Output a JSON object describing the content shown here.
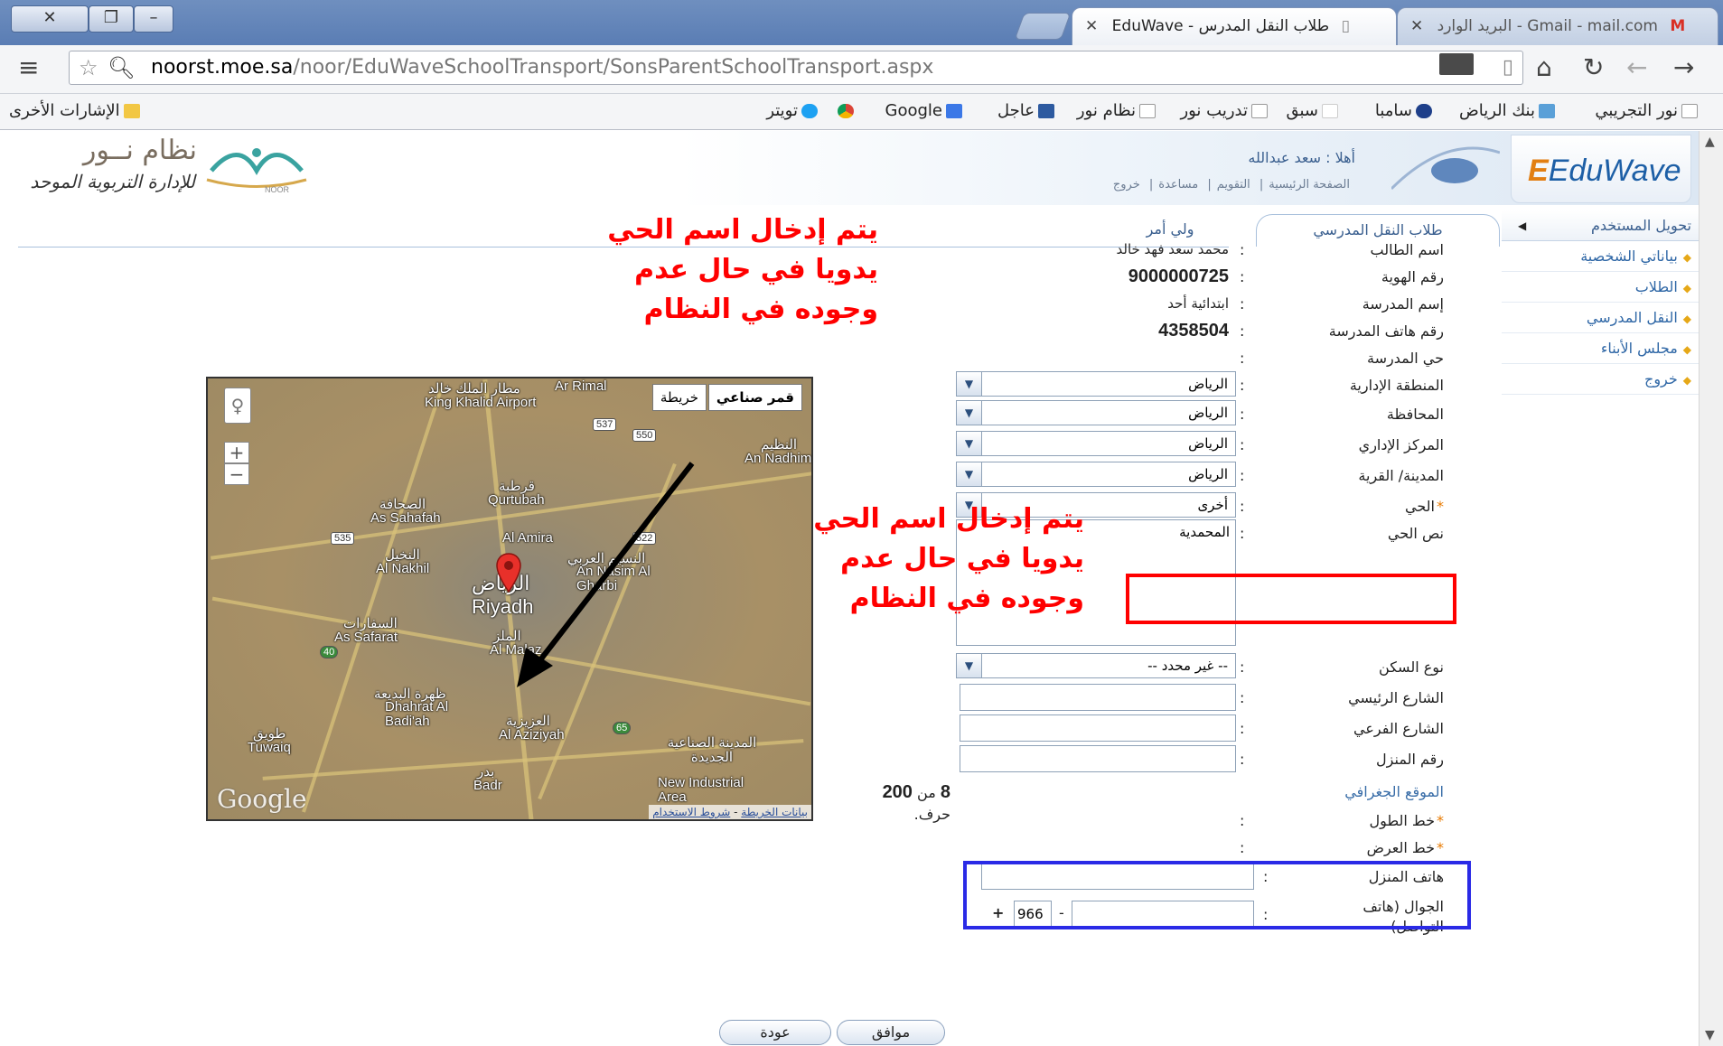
{
  "browser": {
    "tabs": [
      {
        "title": "EduWave - طلاب النقل المدرس",
        "active": true
      },
      {
        "title": "البريد الوارد - Gmail - mail.com",
        "active": false
      }
    ],
    "url_host": "noorst.moe.sa",
    "url_path": "/noor/EduWaveSchoolTransport/SonsParentSchoolTransport.aspx",
    "bookmarks": [
      "نور التجريبي",
      "بنك الرياض",
      "سامبا",
      "سبق",
      "تدريب نور",
      "نظام نور",
      "عاجل",
      "Google",
      "تويتر"
    ],
    "other_bookmarks": "الإشارات الأخرى"
  },
  "header": {
    "eduwave_logo": "EduWave",
    "hello": "أهلا : سعد عبدالله",
    "links": [
      "الصفحة الرئيسية",
      "التقويم",
      "مساعدة",
      "خروج"
    ],
    "noor_title": "نظام نــور",
    "noor_subtitle": "للإدارة التربوية الموحد",
    "noor_small": "NOOR"
  },
  "page_tabs": {
    "active": "طلاب النقل المدرسي",
    "other": "ولي أمر"
  },
  "sidebar": {
    "head": "تحويل المستخدم",
    "items": [
      "بياناتي الشخصية",
      "الطلاب",
      "النقل المدرسي",
      "مجلس الأبناء",
      "خروج"
    ]
  },
  "form": {
    "student_name_label": "اسم الطالب",
    "student_name": "محمد سعد فهد خالد",
    "id_label": "رقم الهوية",
    "id_value": "9000000725",
    "school_label": "إسم المدرسة",
    "school_value": "ابتدائية أحد",
    "school_phone_label": "رقم هاتف المدرسة",
    "school_phone": "4358504",
    "school_district_label": "حي المدرسة",
    "region_label": "المنطقة الإدارية",
    "region": "الرياض",
    "governorate_label": "المحافظة",
    "governorate": "الرياض",
    "center_label": "المركز الإداري",
    "center": "الرياض",
    "city_label": "المدينة/ القرية",
    "city": "الرياض",
    "district_label": "الحي",
    "district": "أخرى",
    "district_text_label": "نص الحي",
    "district_text": "المحمدية",
    "char_count": "8",
    "char_of": "من",
    "char_max": "200",
    "char_unit": "حرف.",
    "housing_label": "نوع السكن",
    "housing": "-- غير محدد --",
    "main_street_label": "الشارع الرئيسي",
    "side_street_label": "الشارع الفرعي",
    "house_no_label": "رقم المنزل",
    "geo_title": "الموقع الجغرافي",
    "longitude_label": "خط الطول",
    "latitude_label": "خط العرض",
    "home_phone_label": "هاتف المنزل",
    "mobile_label": "الجوال (هاتف التواصل)",
    "mobile_prefix": "966",
    "plus": "+",
    "dash": "-",
    "colon": ":"
  },
  "buttons": {
    "ok": "موافق",
    "back": "عودة"
  },
  "map": {
    "type_satellite": "قمر صناعي",
    "type_map": "خريطة",
    "labels": {
      "airport_ar": "مطار الملك خالد",
      "airport_en": "King Khalid Airport",
      "ar_rimal": "Ar Rimal",
      "an_nadhim_ar": "النظيم",
      "an_nadhim": "An Nadhim",
      "sahafah_ar": "الصحافة",
      "sahafah": "As Sahafah",
      "qurtubah_ar": "قرطبة",
      "qurtubah": "Qurtubah",
      "amira": "Al Amira",
      "nakhil_ar": "النخيل",
      "nakhil": "Al Nakhil",
      "riyadh_ar": "الرياض",
      "riyadh": "Riyadh",
      "naseem_ar": "النسيم العربي",
      "naseem": "An Nasim Al Gharbi",
      "safarat_ar": "السفارات",
      "safarat": "As Safarat",
      "malaz_ar": "الملز",
      "malaz": "Al Malaz",
      "dhahrat_ar": "ظهرة البديعة",
      "dhahrat": "Dhahrat Al Badi'ah",
      "aziziyah_ar": "العزيزية",
      "aziziyah": "Al Aziziyah",
      "tuwaiq_ar": "طويق",
      "tuwaiq": "Tuwaiq",
      "badr_ar": "بدر",
      "badr": "Badr",
      "industrial_ar": "المدينة الصناعية الجديدة",
      "industrial": "New Industrial Area"
    },
    "shields": [
      "537",
      "550",
      "535",
      "522",
      "40",
      "65"
    ],
    "google": "Google",
    "terms_data": "بيانات الخريطة",
    "terms_sep": "-",
    "terms_use": "شروط الاستخدام"
  },
  "annotations": {
    "note_line1": "يتم إدخال اسم الحي",
    "note_line2": "يدويا في حال عدم",
    "note_line3": "وجوده في النظام"
  },
  "colors": {
    "annotation_red": "#ff0000",
    "annotation_blue": "#2a2ae6",
    "link_blue": "#2f67a6",
    "required_orange": "#e87a00"
  }
}
